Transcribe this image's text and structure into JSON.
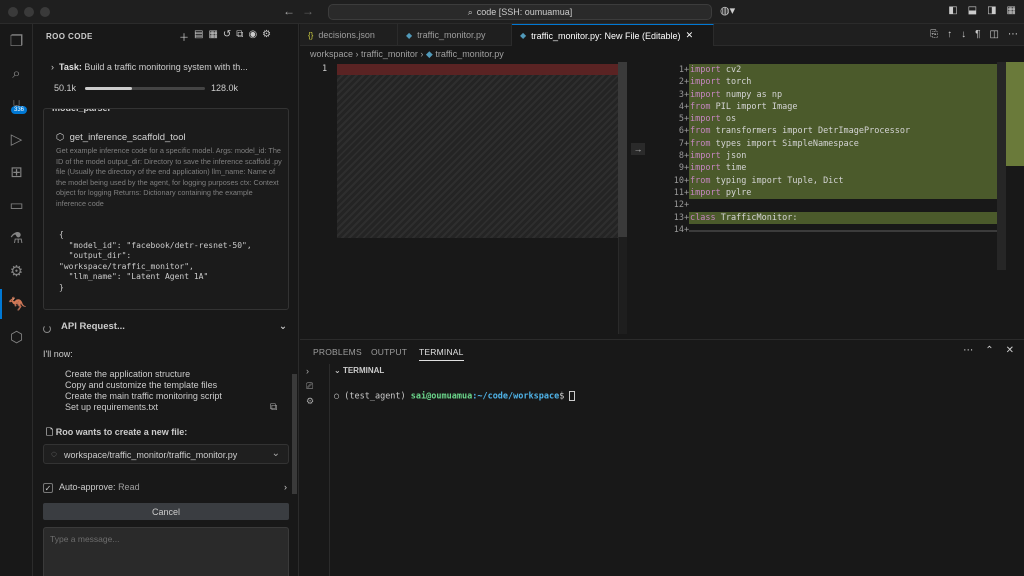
{
  "window": {
    "command_center": "code [SSH: oumuamua]"
  },
  "activity": {
    "source_control_badge": "336"
  },
  "sidebar": {
    "title": "ROO CODE",
    "task": {
      "label": "Task:",
      "text": "Build a traffic monitoring system with th...",
      "tokens_used": "50.1k",
      "tokens_max": "128.0k",
      "progress_fraction": 0.39
    },
    "tool": {
      "header_partial": "model_parser",
      "name": "get_inference_scaffold_tool",
      "description": "Get example inference code for a specific model. Args: model_id: The ID of the model output_dir: Directory to save the inference scaffold .py file (Usually the directory of the end application) llm_name: Name of the model being used by the agent, for logging purposes ctx: Context object for logging Returns: Dictionary containing the example inference code",
      "json": "{\n  \"model_id\": \"facebook/detr-resnet-50\",\n  \"output_dir\":\n\"workspace/traffic_monitor\",\n  \"llm_name\": \"Latent Agent 1A\"\n}"
    },
    "api_request": "API Request...",
    "intro": "I'll now:",
    "steps": [
      "Create the application structure",
      "Copy and customize the template files",
      "Create the main traffic monitoring script",
      "Set up requirements.txt"
    ],
    "new_file_label": "Roo wants to create a new file:",
    "new_file_path": "workspace/traffic_monitor/traffic_monitor.py",
    "auto_approve_label": "Auto-approve:",
    "auto_approve_value": "Read",
    "cancel_label": "Cancel",
    "message_placeholder": "Type a message..."
  },
  "tabs": [
    {
      "label": "decisions.json",
      "type": "json"
    },
    {
      "label": "traffic_monitor.py",
      "type": "py"
    },
    {
      "label": "traffic_monitor.py: New File (Editable)",
      "type": "py",
      "active": true
    }
  ],
  "breadcrumb": [
    "workspace",
    "traffic_monitor",
    "traffic_monitor.py"
  ],
  "diff": {
    "left_line": "1",
    "lines": [
      {
        "n": "1",
        "kw": "import",
        "rest": " cv2"
      },
      {
        "n": "2",
        "kw": "import",
        "rest": " torch"
      },
      {
        "n": "3",
        "kw": "import",
        "rest": " numpy as np"
      },
      {
        "n": "4",
        "kw": "from",
        "rest": " PIL import Image"
      },
      {
        "n": "5",
        "kw": "import",
        "rest": " os"
      },
      {
        "n": "6",
        "kw": "from",
        "rest": " transformers import DetrImageProcessor"
      },
      {
        "n": "7",
        "kw": "from",
        "rest": " types import SimpleNamespace"
      },
      {
        "n": "8",
        "kw": "import",
        "rest": " json"
      },
      {
        "n": "9",
        "kw": "import",
        "rest": " time"
      },
      {
        "n": "10",
        "kw": "from",
        "rest": " typing import Tuple, Dict"
      },
      {
        "n": "11",
        "kw": "import",
        "rest": " pylre"
      },
      {
        "n": "12",
        "kw": "",
        "rest": ""
      },
      {
        "n": "13",
        "kw": "class",
        "rest": " TrafficMonitor:"
      },
      {
        "n": "14",
        "kw": "",
        "rest": ""
      }
    ]
  },
  "panel": {
    "tabs": [
      "PROBLEMS",
      "OUTPUT",
      "TERMINAL"
    ],
    "section": "TERMINAL",
    "prompt_env": "(test_agent)",
    "prompt_user": "sai@oumuamua",
    "prompt_path": ":~/code/workspace",
    "prompt_symbol": "$"
  }
}
